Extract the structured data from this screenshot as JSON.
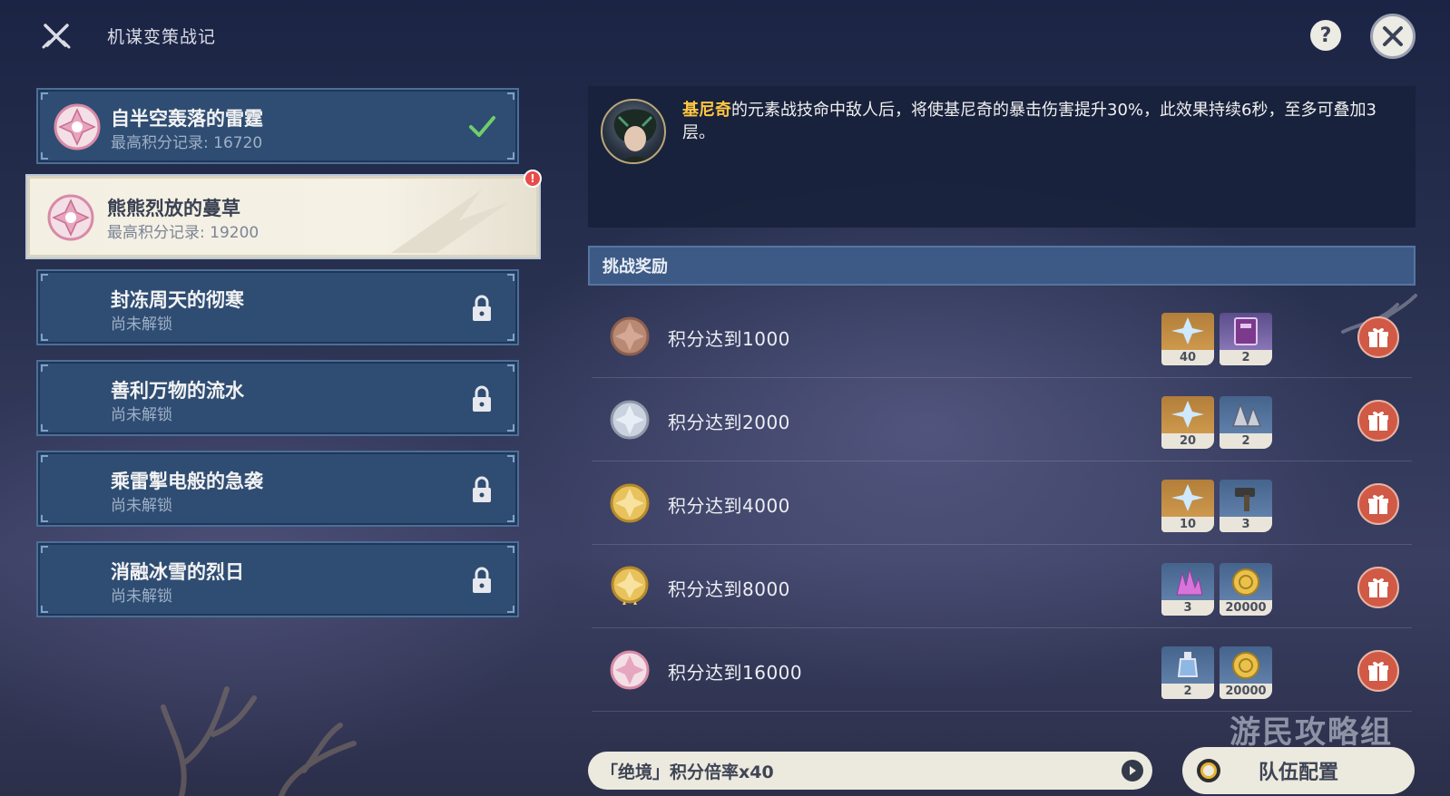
{
  "header": {
    "title": "机谋变策战记",
    "help_label": "?",
    "icons": {
      "logo": "crossed-swords-icon",
      "help": "question-icon",
      "close": "close-icon"
    }
  },
  "challenges": [
    {
      "name": "自半空轰落的雷霆",
      "subtitle": "最高积分记录: 16720",
      "status": "completed",
      "active": false
    },
    {
      "name": "熊熊烈放的蔓草",
      "subtitle": "最高积分记录: 19200",
      "status": "new",
      "active": true,
      "alert": "!"
    },
    {
      "name": "封冻周天的彻寒",
      "subtitle": "尚未解锁",
      "status": "locked",
      "active": false
    },
    {
      "name": "善利万物的流水",
      "subtitle": "尚未解锁",
      "status": "locked",
      "active": false
    },
    {
      "name": "乘雷掣电般的急袭",
      "subtitle": "尚未解锁",
      "status": "locked",
      "active": false
    },
    {
      "name": "消融冰雪的烈日",
      "subtitle": "尚未解锁",
      "status": "locked",
      "active": false
    }
  ],
  "description": {
    "highlight": "基尼奇",
    "text": "的元素战技命中敌人后，将使基尼奇的暴击伤害提升30%，此效果持续6秒，至多可叠加3层。"
  },
  "rewards": {
    "header": "挑战奖励",
    "rows": [
      {
        "label": "积分达到1000",
        "medal": "bronze",
        "items": [
          {
            "icon": "primogem-icon",
            "qty": "40",
            "rarity": "gold"
          },
          {
            "icon": "book-icon",
            "qty": "2",
            "rarity": "purple"
          }
        ]
      },
      {
        "label": "积分达到2000",
        "medal": "silver",
        "items": [
          {
            "icon": "primogem-icon",
            "qty": "20",
            "rarity": "gold"
          },
          {
            "icon": "ore-icon",
            "qty": "2",
            "rarity": "blue"
          }
        ]
      },
      {
        "label": "积分达到4000",
        "medal": "gold",
        "items": [
          {
            "icon": "primogem-icon",
            "qty": "10",
            "rarity": "gold"
          },
          {
            "icon": "hammer-icon",
            "qty": "3",
            "rarity": "blue"
          }
        ]
      },
      {
        "label": "积分达到8000",
        "medal": "gold-plus",
        "items": [
          {
            "icon": "crystal-icon",
            "qty": "3",
            "rarity": "blue"
          },
          {
            "icon": "mora-icon",
            "qty": "20000",
            "rarity": "blue"
          }
        ]
      },
      {
        "label": "积分达到16000",
        "medal": "pink",
        "items": [
          {
            "icon": "potion-icon",
            "qty": "2",
            "rarity": "blue"
          },
          {
            "icon": "mora-icon",
            "qty": "20000",
            "rarity": "blue"
          }
        ]
      }
    ]
  },
  "bottom": {
    "multiplier": "「绝境」积分倍率x40",
    "team_button": "队伍配置"
  },
  "watermark": "游民攻略组",
  "colors": {
    "accent": "#ffc640",
    "gift": "#d05a45",
    "panel": "#2f4d73"
  }
}
